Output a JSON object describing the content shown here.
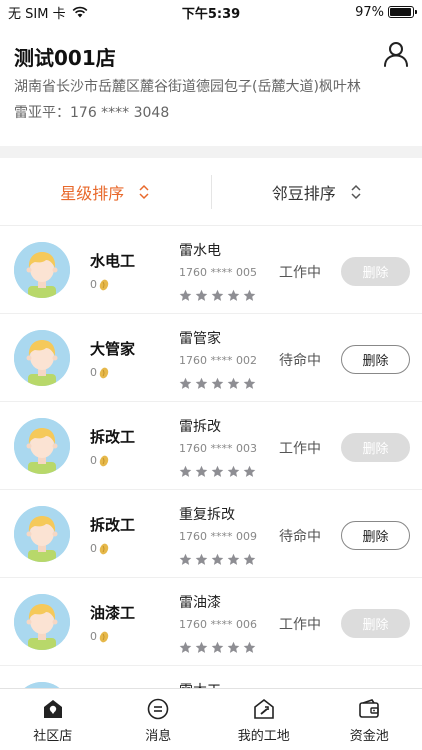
{
  "status_bar": {
    "carrier": "无 SIM 卡",
    "time": "下午5:39",
    "battery": "97%",
    "battery_level": 0.97
  },
  "store": {
    "name": "测试001店",
    "address": "湖南省长沙市岳麓区麓谷街道德园包子(岳麓大道)枫叶林",
    "contact": "雷亚平：176 **** 3048"
  },
  "sort": {
    "star_label": "星级排序",
    "bean_label": "邻豆排序"
  },
  "workers": [
    {
      "role": "水电工",
      "beans": "0",
      "name": "雷水电",
      "phone": "1760 **** 005",
      "status": "工作中",
      "delete_label": "删除",
      "delete_enabled": false,
      "rating": 0
    },
    {
      "role": "大管家",
      "beans": "0",
      "name": "雷管家",
      "phone": "1760 **** 002",
      "status": "待命中",
      "delete_label": "删除",
      "delete_enabled": true,
      "rating": 0
    },
    {
      "role": "拆改工",
      "beans": "0",
      "name": "雷拆改",
      "phone": "1760 **** 003",
      "status": "工作中",
      "delete_label": "删除",
      "delete_enabled": false,
      "rating": 0
    },
    {
      "role": "拆改工",
      "beans": "0",
      "name": "重复拆改",
      "phone": "1760 **** 009",
      "status": "待命中",
      "delete_label": "删除",
      "delete_enabled": true,
      "rating": 0
    },
    {
      "role": "油漆工",
      "beans": "0",
      "name": "雷油漆",
      "phone": "1760 **** 006",
      "status": "工作中",
      "delete_label": "删除",
      "delete_enabled": false,
      "rating": 0
    },
    {
      "role": "",
      "beans": "",
      "name": "雷木工",
      "phone": "",
      "status": "",
      "delete_label": "",
      "delete_enabled": false,
      "rating": 0
    }
  ],
  "tabs": [
    {
      "label": "社区店",
      "icon": "store-icon",
      "active": true
    },
    {
      "label": "消息",
      "icon": "message-icon",
      "active": false
    },
    {
      "label": "我的工地",
      "icon": "construction-site-icon",
      "active": false
    },
    {
      "label": "资金池",
      "icon": "wallet-icon",
      "active": false
    }
  ],
  "colors": {
    "accent": "#e8692c",
    "star": "#8e8e93",
    "avatar_bg": "#aad8ef"
  }
}
